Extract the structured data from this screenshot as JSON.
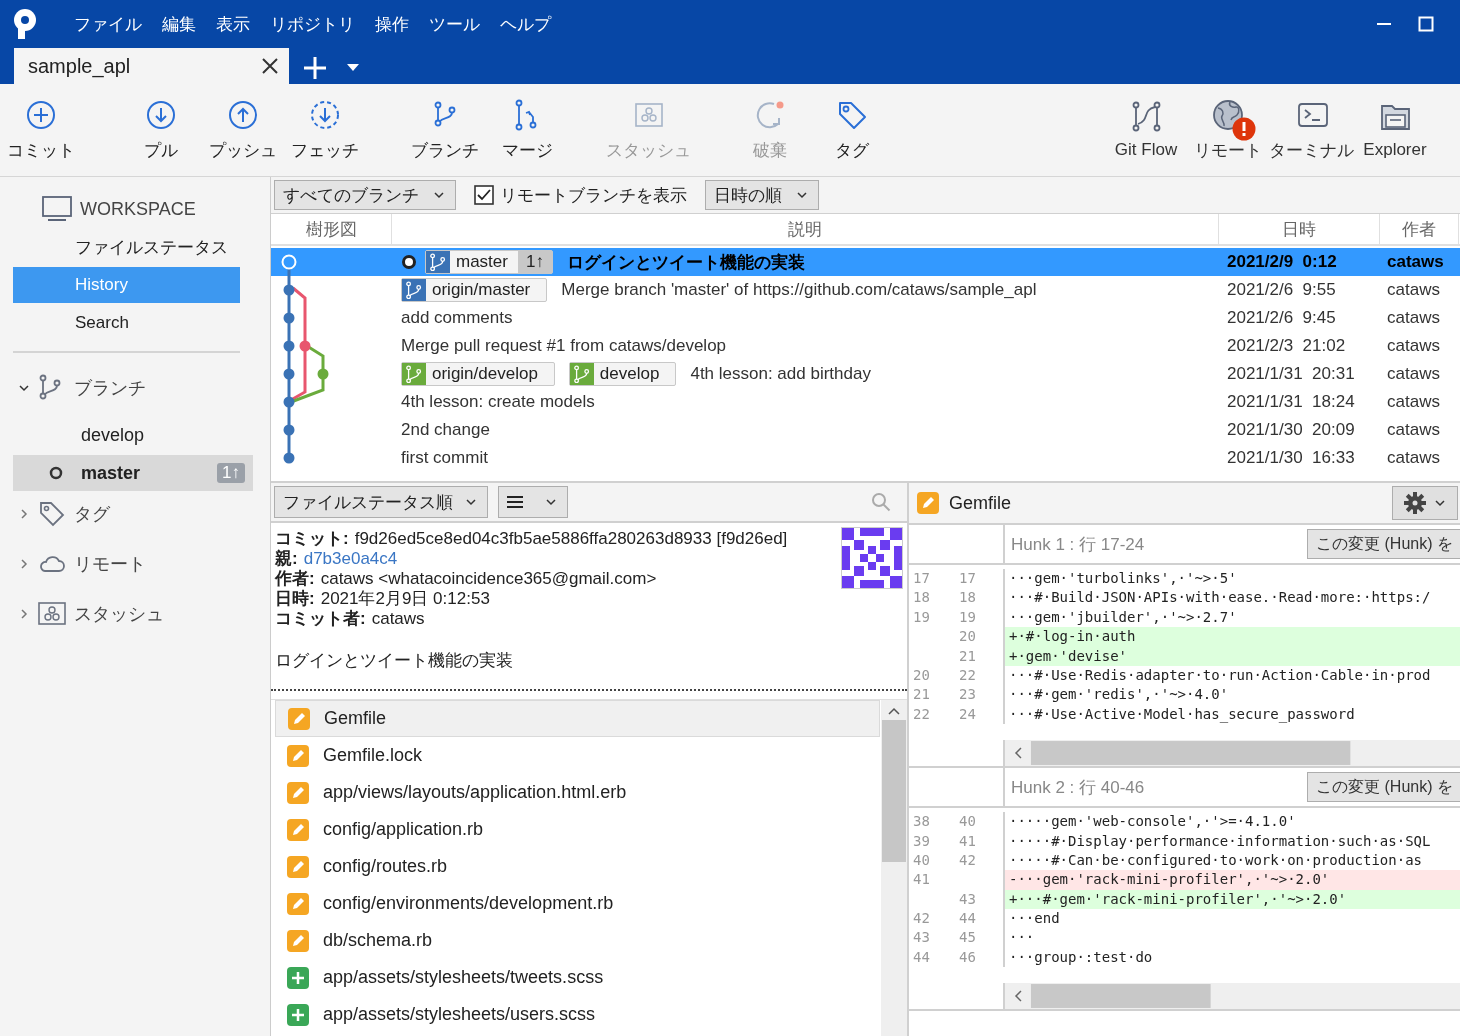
{
  "menu": [
    "ファイル",
    "編集",
    "表示",
    "リポジトリ",
    "操作",
    "ツール",
    "ヘルプ"
  ],
  "tabs": [
    {
      "label": "sample_apl",
      "selected": true
    }
  ],
  "toolbar": {
    "groups": [
      [
        {
          "kind": "commit",
          "label": "コミット",
          "disabled": false
        }
      ],
      [
        {
          "kind": "pull",
          "label": "プル",
          "disabled": false
        },
        {
          "kind": "push",
          "label": "プッシュ",
          "disabled": false
        },
        {
          "kind": "fetch",
          "label": "フェッチ",
          "disabled": false
        }
      ],
      [
        {
          "kind": "branch",
          "label": "ブランチ",
          "disabled": false
        },
        {
          "kind": "merge",
          "label": "マージ",
          "disabled": false
        }
      ],
      [
        {
          "kind": "stash",
          "label": "スタッシュ",
          "disabled": true
        }
      ],
      [
        {
          "kind": "discard",
          "label": "破棄",
          "disabled": true
        },
        {
          "kind": "tag",
          "label": "タグ",
          "disabled": false
        }
      ]
    ],
    "right": [
      {
        "kind": "gitflow",
        "label": "Git Flow",
        "alert": false
      },
      {
        "kind": "remote",
        "label": "リモート",
        "alert": true
      },
      {
        "kind": "terminal",
        "label": "ターミナル",
        "alert": false
      },
      {
        "kind": "explorer",
        "label": "Explorer",
        "alert": false
      }
    ]
  },
  "sidebar": {
    "workspace": {
      "title": "WORKSPACE",
      "items": [
        {
          "label": "ファイルステータス",
          "selected": false
        },
        {
          "label": "History",
          "selected": true
        },
        {
          "label": "Search",
          "selected": false
        }
      ]
    },
    "groups": [
      {
        "kind": "branch",
        "label": "ブランチ",
        "expanded": true,
        "children": [
          {
            "label": "develop",
            "current": false,
            "selected": false
          },
          {
            "label": "master",
            "current": true,
            "selected": true,
            "badge": "1↑"
          }
        ]
      },
      {
        "kind": "tag",
        "label": "タグ",
        "expanded": false
      },
      {
        "kind": "remote",
        "label": "リモート",
        "expanded": false
      },
      {
        "kind": "stash",
        "label": "スタッシュ",
        "expanded": false
      }
    ]
  },
  "history": {
    "branch_filter": "すべてのブランチ",
    "show_remote": {
      "label": "リモートブランチを表示",
      "checked": true
    },
    "sort": "日時の順",
    "columns": [
      "樹形図",
      "説明",
      "日時",
      "作者"
    ],
    "rows": [
      {
        "selected": true,
        "head": true,
        "refs": [
          {
            "name": "master",
            "color": "#3a72b5",
            "ahead": "1↑"
          }
        ],
        "message": "ログインとツイート機能の実装",
        "date": "2021/2/9  0:12",
        "author": "cataws"
      },
      {
        "selected": false,
        "head": false,
        "refs": [
          {
            "name": "origin/master",
            "color": "#3a72b5"
          }
        ],
        "message": "Merge branch 'master' of https://github.com/cataws/sample_apl",
        "date": "2021/2/6  9:55",
        "author": "cataws"
      },
      {
        "selected": false,
        "head": false,
        "message": "add comments",
        "date": "2021/2/6  9:45",
        "author": "cataws"
      },
      {
        "selected": false,
        "head": false,
        "message": "Merge pull request #1 from cataws/develop",
        "date": "2021/2/3  21:02",
        "author": "cataws"
      },
      {
        "selected": false,
        "head": false,
        "refs": [
          {
            "name": "origin/develop",
            "color": "#6aab3c"
          },
          {
            "name": "develop",
            "color": "#6aab3c"
          }
        ],
        "message": "4th lesson: add birthday",
        "date": "2021/1/31  20:31",
        "author": "cataws"
      },
      {
        "selected": false,
        "head": false,
        "message": "4th lesson: create models",
        "date": "2021/1/31  18:24",
        "author": "cataws"
      },
      {
        "selected": false,
        "head": false,
        "message": "2nd change",
        "date": "2021/1/30  20:09",
        "author": "cataws"
      },
      {
        "selected": false,
        "head": false,
        "message": "first commit",
        "date": "2021/1/30  16:33",
        "author": "cataws"
      }
    ]
  },
  "details": {
    "file_sort": "ファイルステータス順",
    "fields": [
      {
        "kind": "text",
        "label": "コミット:",
        "value": "f9d26ed5ce8ed04c3fb5ae5886ffa280263d8933 [f9d26ed]"
      },
      {
        "kind": "link",
        "label": "親:",
        "value": "d7b3e0a4c4"
      },
      {
        "kind": "text",
        "label": "作者:",
        "value": "cataws <whatacoincidence365@gmail.com>"
      },
      {
        "kind": "text",
        "label": "日時:",
        "value": "2021年2月9日 0:12:53"
      },
      {
        "kind": "text",
        "label": "コミット者:",
        "value": "cataws"
      }
    ],
    "message": "ログインとツイート機能の実装",
    "files": [
      {
        "path": "Gemfile",
        "kind": "modified",
        "selected": true
      },
      {
        "path": "Gemfile.lock",
        "kind": "modified",
        "selected": false
      },
      {
        "path": "app/views/layouts/application.html.erb",
        "kind": "modified",
        "selected": false
      },
      {
        "path": "config/application.rb",
        "kind": "modified",
        "selected": false
      },
      {
        "path": "config/routes.rb",
        "kind": "modified",
        "selected": false
      },
      {
        "path": "config/environments/development.rb",
        "kind": "modified",
        "selected": false
      },
      {
        "path": "db/schema.rb",
        "kind": "modified",
        "selected": false
      },
      {
        "path": "app/assets/stylesheets/tweets.scss",
        "kind": "added",
        "selected": false
      },
      {
        "path": "app/assets/stylesheets/users.scss",
        "kind": "added",
        "selected": false
      }
    ]
  },
  "diff": {
    "file": "Gemfile",
    "kind": "modified",
    "hunks": [
      {
        "title": "Hunk 1 : 行 17-24",
        "action": "この変更 (Hunk) を",
        "lines": [
          {
            "kind": "context",
            "old": "17",
            "new": "17",
            "text": "···gem·'turbolinks',·'~>·5'"
          },
          {
            "kind": "context",
            "old": "18",
            "new": "18",
            "text": "···#·Build·JSON·APIs·with·ease.·Read·more:·https:/"
          },
          {
            "kind": "context",
            "old": "19",
            "new": "19",
            "text": "···gem·'jbuilder',·'~>·2.7'"
          },
          {
            "kind": "added",
            "new": "20",
            "text": "+·#·log-in·auth"
          },
          {
            "kind": "added",
            "new": "21",
            "text": "+·gem·'devise'"
          },
          {
            "kind": "context",
            "old": "20",
            "new": "22",
            "text": "···#·Use·Redis·adapter·to·run·Action·Cable·in·prod"
          },
          {
            "kind": "context",
            "old": "21",
            "new": "23",
            "text": "···#·gem·'redis',·'~>·4.0'"
          },
          {
            "kind": "context",
            "old": "22",
            "new": "24",
            "text": "···#·Use·Active·Model·has_secure_password"
          }
        ]
      },
      {
        "title": "Hunk 2 : 行 40-46",
        "action": "この変更 (Hunk) を",
        "lines": [
          {
            "kind": "context",
            "old": "38",
            "new": "40",
            "text": "·····gem·'web-console',·'>=·4.1.0'"
          },
          {
            "kind": "context",
            "old": "39",
            "new": "41",
            "text": "·····#·Display·performance·information·such·as·SQL"
          },
          {
            "kind": "context",
            "old": "40",
            "new": "42",
            "text": "·····#·Can·be·configured·to·work·on·production·as"
          },
          {
            "kind": "removed",
            "old": "41",
            "text": "-···gem·'rack-mini-profiler',·'~>·2.0'"
          },
          {
            "kind": "added",
            "new": "43",
            "text": "+···#·gem·'rack-mini-profiler',·'~>·2.0'"
          },
          {
            "kind": "context",
            "old": "42",
            "new": "44",
            "text": "···end"
          },
          {
            "kind": "context",
            "old": "43",
            "new": "45",
            "text": "···"
          },
          {
            "kind": "context",
            "old": "44",
            "new": "46",
            "text": "···group·:test·do"
          }
        ]
      }
    ]
  }
}
